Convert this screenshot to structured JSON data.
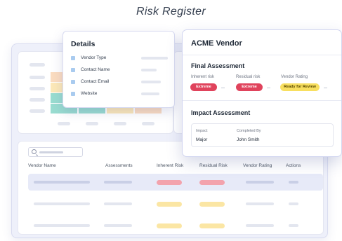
{
  "page": {
    "title": "Risk Register"
  },
  "details": {
    "title": "Details",
    "fields": [
      {
        "label": "Vendor Type"
      },
      {
        "label": "Contact Name"
      },
      {
        "label": "Contact Email"
      },
      {
        "label": "Website"
      }
    ]
  },
  "vendor": {
    "title": "ACME Vendor",
    "final_assessment": {
      "title": "Final Assessment",
      "inherent_label": "Inherent risk",
      "inherent_value": "Extreme",
      "residual_label": "Residual risk",
      "residual_value": "Extreme",
      "rating_label": "Vendor Rating",
      "rating_value": "Ready for Review"
    },
    "impact_assessment": {
      "title": "Impact Assessment",
      "impact_label": "Impact",
      "impact_value": "Major",
      "completed_label": "Completed By",
      "completed_value": "John Smith"
    }
  },
  "table": {
    "headers": [
      "Vendor Name",
      "Assessments",
      "Inherent Risk",
      "Residual Risk",
      "Vendor Rating",
      "Actions"
    ]
  },
  "colors": {
    "extreme": "#e0435c",
    "ready_for_review": "#f8df60",
    "accent_bg": "#eef0fa"
  }
}
